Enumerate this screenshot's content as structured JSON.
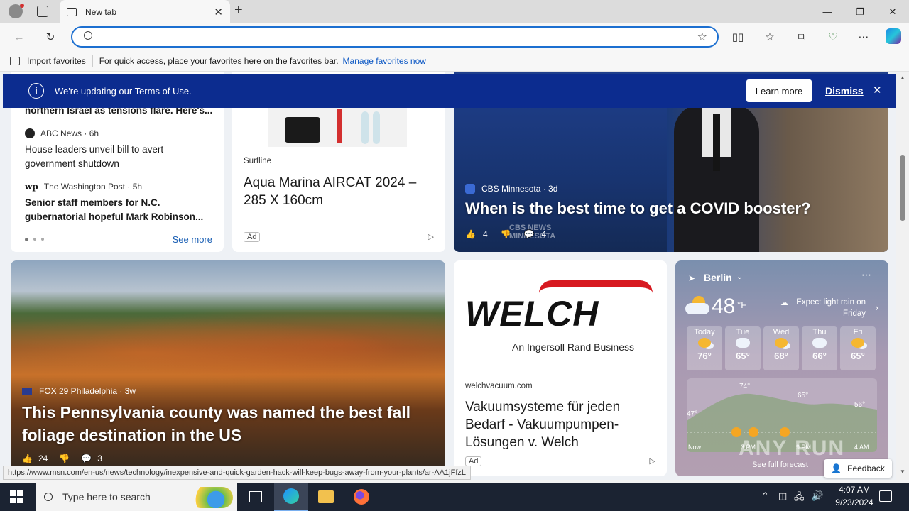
{
  "browser": {
    "tab_title": "New tab",
    "favbar": {
      "import": "Import favorites",
      "hint": "For quick access, place your favorites here on the favorites bar.",
      "manage": "Manage favorites now"
    }
  },
  "banner": {
    "text": "We're updating our Terms of Use.",
    "learn_more": "Learn more",
    "dismiss": "Dismiss"
  },
  "news_list": {
    "top_snippet": "northern Israel as tensions flare. Here's...",
    "items": [
      {
        "source": "ABC News",
        "age": "6h",
        "title": "House leaders unveil bill to avert government shutdown"
      },
      {
        "source": "The Washington Post",
        "age": "5h",
        "title": "Senior staff members for N.C. gubernatorial hopeful Mark Robinson..."
      }
    ],
    "see_more": "See more"
  },
  "ad1": {
    "source": "Surfline",
    "title": "Aqua Marina AIRCAT 2024 – 285 X 160cm",
    "ad": "Ad"
  },
  "cbs": {
    "source": "CBS Minnesota",
    "age": "3d",
    "title": "When is the best time to get a COVID booster?",
    "likes": "4",
    "comments": "4",
    "watermark": "CBS NEWS MINNESOTA"
  },
  "fox": {
    "source": "FOX 29 Philadelphia",
    "age": "3w",
    "title": "This Pennsylvania county was named the best fall foliage destination in the US",
    "likes": "24",
    "comments": "3"
  },
  "welch": {
    "logo": "WELCH",
    "tagline": "An Ingersoll Rand Business",
    "domain": "welchvacuum.com",
    "title": "Vakuumsysteme für jeden Bedarf - Vakuumpumpen-Lösungen v. Welch",
    "ad": "Ad"
  },
  "weather": {
    "city": "Berlin",
    "temp": "48",
    "unit": "°F",
    "forecast_note": "Expect light rain on Friday",
    "days": [
      {
        "name": "Today",
        "temp": "76°"
      },
      {
        "name": "Tue",
        "temp": "65°"
      },
      {
        "name": "Wed",
        "temp": "68°"
      },
      {
        "name": "Thu",
        "temp": "66°"
      },
      {
        "name": "Fri",
        "temp": "65°"
      }
    ],
    "chart_labels": {
      "a": "74°",
      "b": "65°",
      "c": "47°",
      "d": "56°"
    },
    "times": [
      "Now",
      "3 PM",
      "9 PM",
      "4 AM"
    ],
    "see_full": "See full forecast",
    "feedback": "Feedback"
  },
  "status_url": "https://www.msn.com/en-us/news/technology/inexpensive-and-quick-garden-hack-will-keep-bugs-away-from-your-plants/ar-AA1jFfzL",
  "taskbar": {
    "search_placeholder": "Type here to search",
    "time": "4:07 AM",
    "date": "9/23/2024"
  },
  "watermark": "ANY RUN"
}
